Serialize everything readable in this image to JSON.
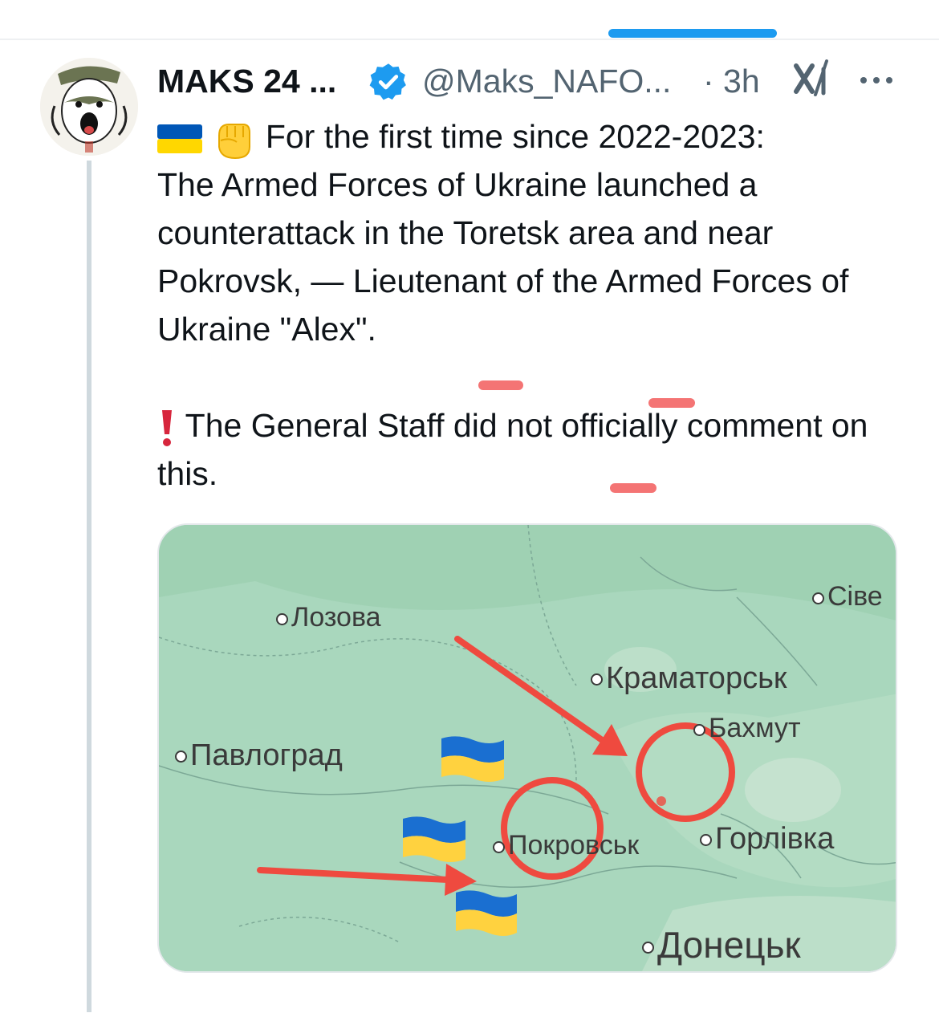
{
  "author": {
    "display_name": "MAKS 24 ...",
    "handle": "@Maks_NAFO...",
    "time": "· 3h"
  },
  "icons": {
    "verified": "verified-badge-icon",
    "xai": "grok-xai-icon",
    "more": "more-options-icon",
    "flag": "ukraine-flag-emoji",
    "fist": "raised-fist-emoji",
    "exclamation": "red-exclamation-emoji"
  },
  "tweet": {
    "line1": "For the first time since 2022-2023:",
    "body": "The Armed Forces of Ukraine launched a counterattack in the Toretsk area and near Pokrovsk, — Lieutenant of the Armed Forces of Ukraine \"Alex\".",
    "note": "The General Staff did not officially comment on this."
  },
  "map": {
    "cities": {
      "lozova": "Лозова",
      "sive": "Сіве",
      "kramatorsk": "Краматорськ",
      "bakhmut": "Бахмут",
      "pavlohrad": "Павлоград",
      "pokrovsk": "Покровськ",
      "horlivka": "Горлівка",
      "donetsk": "Донецьк"
    }
  },
  "colors": {
    "accent": "#1d9bf0",
    "text": "#0f1419",
    "secondary": "#536471",
    "map_land": "#a9d7bd",
    "arrow": "#ef4a3f",
    "flag_blue": "#0057b7",
    "flag_yellow": "#ffd700"
  }
}
